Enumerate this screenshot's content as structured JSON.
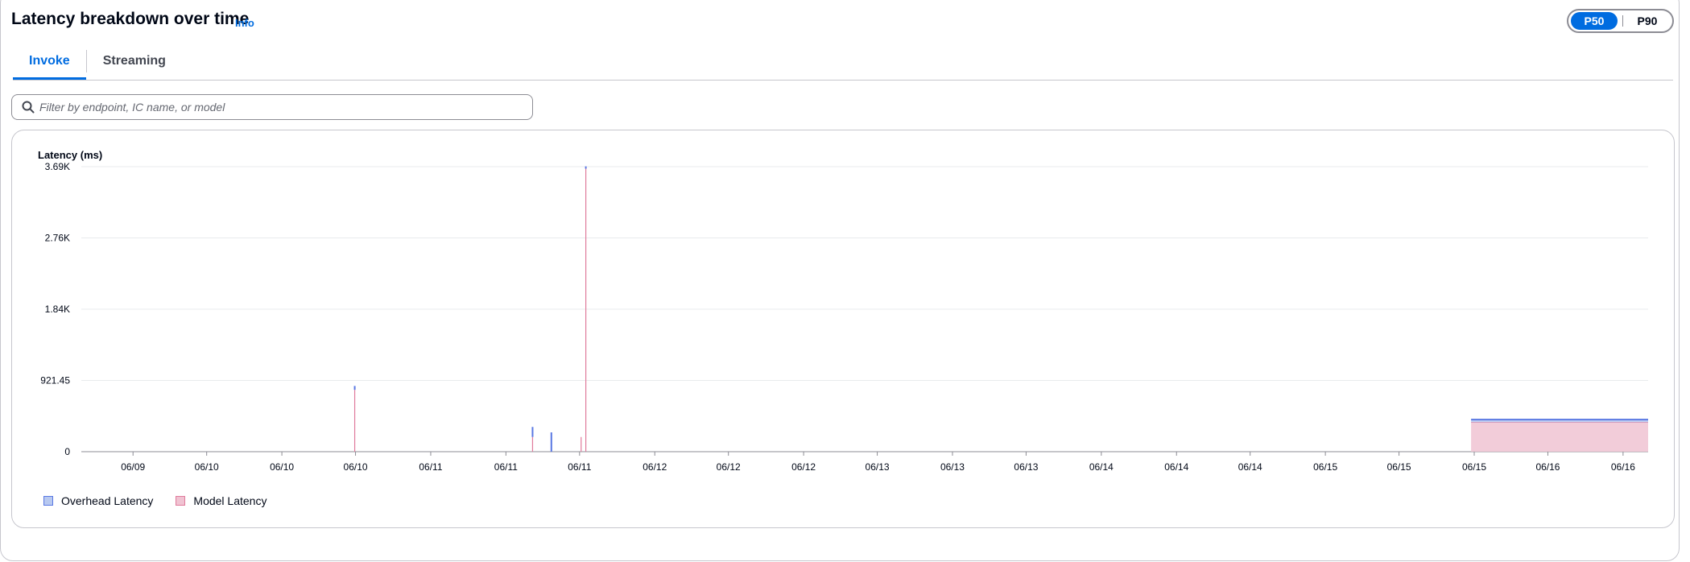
{
  "header": {
    "title": "Latency breakdown over time",
    "info_label": "Info"
  },
  "percentile_toggle": {
    "options": [
      "P50",
      "P90"
    ],
    "selected": "P50"
  },
  "tabs": [
    {
      "label": "Invoke",
      "active": true
    },
    {
      "label": "Streaming",
      "active": false
    }
  ],
  "filter": {
    "placeholder": "Filter by endpoint, IC name, or model",
    "value": ""
  },
  "colors": {
    "accent": "#006ce0",
    "overhead_fill": "#b8c9f0",
    "overhead_stroke": "#5978e3",
    "model_fill": "#f0c3d2",
    "model_stroke": "#e07a9b"
  },
  "chart_data": {
    "type": "area",
    "ylabel": "Latency (ms)",
    "ylim": [
      0,
      3686
    ],
    "y_ticks": [
      0,
      921.45,
      1843,
      2764,
      3686
    ],
    "y_tick_labels": [
      "0",
      "921.45",
      "1.84K",
      "2.76K",
      "3.69K"
    ],
    "xlim": [
      0,
      100
    ],
    "x_ticks": [
      3.3,
      8.0,
      12.8,
      17.5,
      22.3,
      27.1,
      31.8,
      36.6,
      41.3,
      46.1,
      50.8,
      55.6,
      60.3,
      65.1,
      69.9,
      74.6,
      79.4,
      84.1,
      88.9,
      93.6,
      98.4
    ],
    "x_tick_labels": [
      "06/09",
      "06/10",
      "06/10",
      "06/10",
      "06/11",
      "06/11",
      "06/11",
      "06/12",
      "06/12",
      "06/12",
      "06/13",
      "06/13",
      "06/13",
      "06/14",
      "06/14",
      "06/14",
      "06/15",
      "06/15",
      "06/15",
      "06/16",
      "06/16"
    ],
    "grid": true,
    "legend": "bottom-left",
    "series": [
      {
        "name": "Overhead Latency",
        "spikes": [
          {
            "x": 17.45,
            "base": 800,
            "top": 850
          },
          {
            "x": 28.8,
            "base": 190,
            "top": 320
          },
          {
            "x": 30.0,
            "base": 0,
            "top": 250
          },
          {
            "x": 32.2,
            "base": 3660,
            "top": 3690
          }
        ],
        "plateau": {
          "x_start": 88.7,
          "x_end": 100,
          "base": 380,
          "top": 415
        }
      },
      {
        "name": "Model Latency",
        "spikes": [
          {
            "x": 17.45,
            "base": 0,
            "top": 800
          },
          {
            "x": 28.8,
            "base": 0,
            "top": 190
          },
          {
            "x": 31.9,
            "base": 0,
            "top": 190
          },
          {
            "x": 32.2,
            "base": 0,
            "top": 3660
          }
        ],
        "plateau": {
          "x_start": 88.7,
          "x_end": 100,
          "base": 0,
          "top": 380
        }
      }
    ]
  }
}
